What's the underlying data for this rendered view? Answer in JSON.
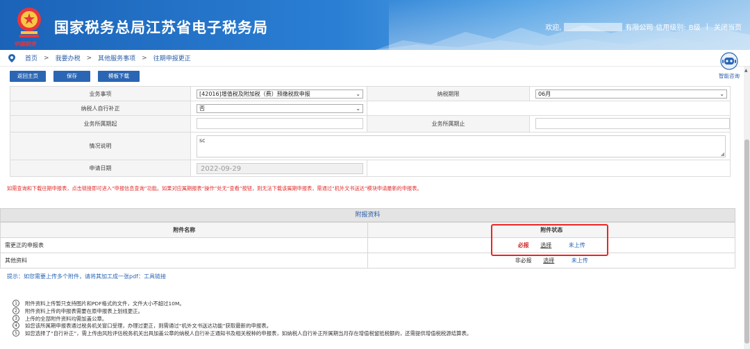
{
  "header": {
    "title": "国家税务总局江苏省电子税务局",
    "logo_script": "中国税务",
    "welcome": "欢迎,",
    "company_suffix": "有限公司",
    "credit_label": "信用级别:",
    "credit_value": "B级",
    "close_page": "关闭当页"
  },
  "breadcrumb": [
    "首页",
    "我要办税",
    "其他服务事项",
    "往期申报更正"
  ],
  "breadcrumb_sep": ">",
  "assistant": {
    "label": "智能咨询"
  },
  "toolbar": {
    "back": "返回主页",
    "save": "保存",
    "template": "模板下载"
  },
  "form": {
    "business_item_label": "业务事项",
    "business_item_value": "[42016]增值税及附加税（费）预缴税款申报",
    "tax_period_label": "纳税期限",
    "tax_period_value": "06月",
    "self_correct_label": "纳税人自行补正",
    "self_correct_value": "否",
    "period_start_label": "业务所属期起",
    "period_end_label": "业务所属期止",
    "description_label": "情况说明",
    "description_value": "sc",
    "apply_date_label": "申请日期",
    "apply_date_value": "2022-09-29"
  },
  "notice_red": "如需查询和下载往期申报表，点击链接即可进入“申报信息查询”功能。如果对应属期报表“操作”处无“查看”按钮，则无法下载该属期申报表，需通过“机外文书送达”模块申请最新的申报表。",
  "attachments": {
    "section_title": "附报资料",
    "col_name": "附件名称",
    "col_status": "附件状态",
    "rows": [
      {
        "name": "需更正的申报表",
        "required": "必报",
        "choose": "选择",
        "upload": "未上传"
      },
      {
        "name": "其他资料",
        "required": "非必报",
        "choose": "选择",
        "upload": "未上传"
      }
    ]
  },
  "tip": "提示：如您需要上传多个附件，请将其加工成一张pdf：工具链接",
  "notes": [
    {
      "num": "1",
      "text": "附件资料上传暂只支持图片和PDF格式的文件，文件大小不超过10M。"
    },
    {
      "num": "2",
      "text": "附件资料上传的申报表需要在原申报表上划线更正。"
    },
    {
      "num": "3",
      "text": "上传的全部附件资料均需加盖公章。"
    },
    {
      "num": "4",
      "text": "如您该所属期申报表通过税务机关窗口受理，办理过更正，则需通过“机外文书送达功能”获取最新的申报表。"
    },
    {
      "num": "5",
      "text": "如您选择了“自行补正”，需上传由风险评估税务机关出具加盖公章的纳税人自行补正通知书及相关税种的申报表，如纳税人自行补正所属期当月存在增值税留抵税额的，还需提供增值税税源结算表。"
    }
  ],
  "colors": {
    "header_blue": "#1b63b8",
    "button_blue": "#2a66b4",
    "required_red": "#d42a2a",
    "link_blue": "#2a66b4"
  }
}
